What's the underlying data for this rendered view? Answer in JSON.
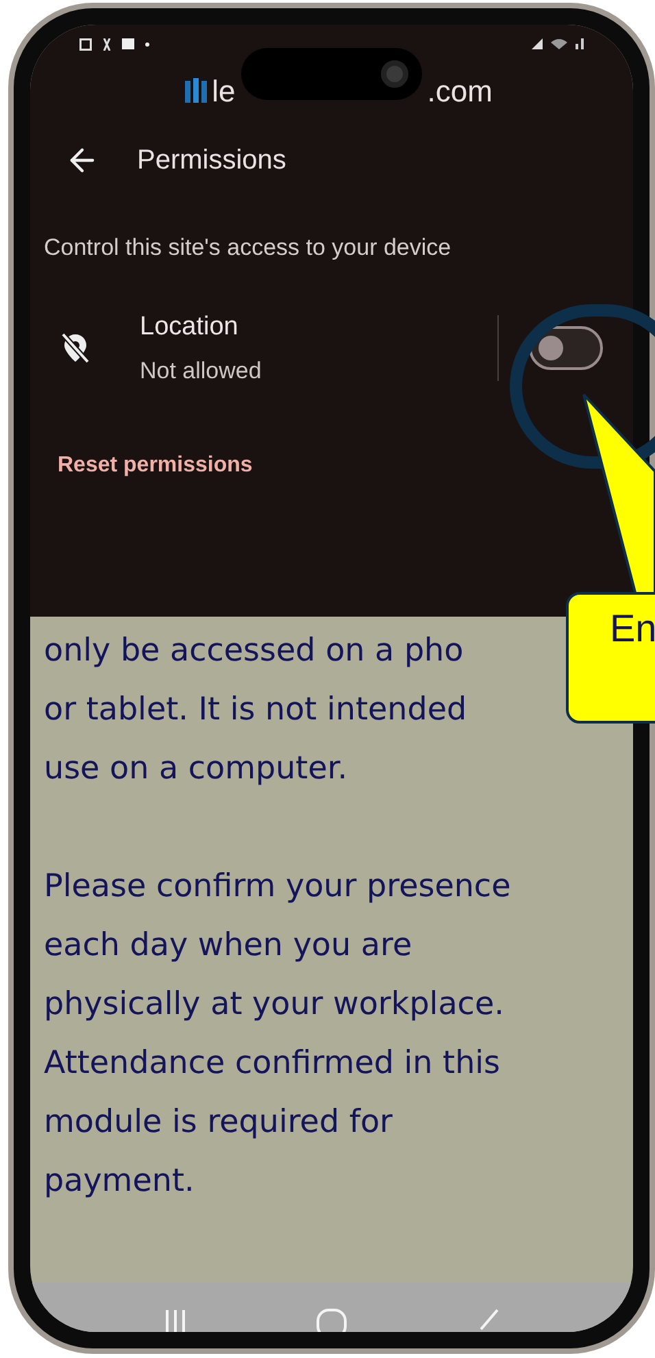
{
  "site": {
    "domain_start": "le",
    "domain_end": ".com"
  },
  "header": {
    "title": "Permissions"
  },
  "subtitle": "Control this site's access to your device",
  "permissions": [
    {
      "name": "Location",
      "status": "Not allowed",
      "on": false
    }
  ],
  "reset_button": "Reset permissions",
  "callout": {
    "text": "En"
  },
  "paragraphs": [
    {
      "lines": [
        "only be accessed on a pho",
        "or tablet. It is not intended",
        "use on a computer."
      ]
    },
    {
      "lines": [
        "Please confirm your presence",
        "each day when you are",
        "physically at your workplace.",
        "Attendance confirmed in this",
        "module is required for",
        "payment."
      ]
    }
  ]
}
